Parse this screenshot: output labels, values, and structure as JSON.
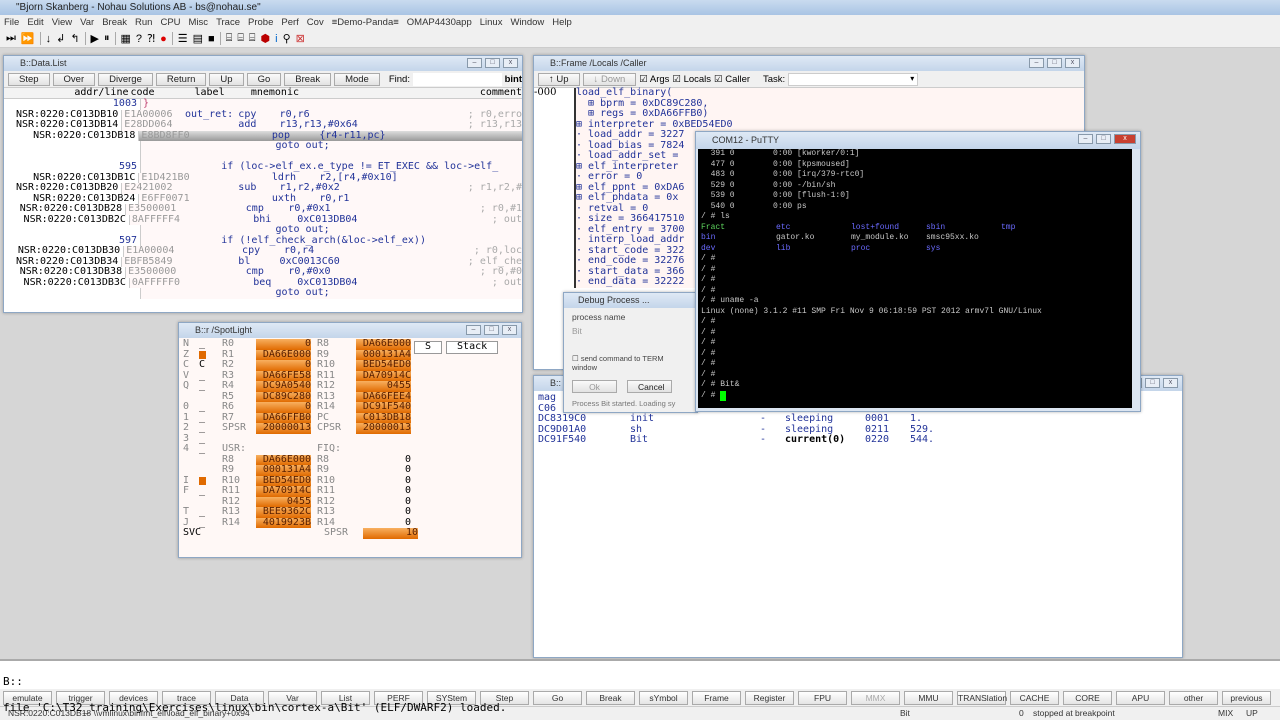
{
  "app": {
    "title": "\"Bjorn Skanberg - Nohau Solutions AB - bs@nohau.se\"",
    "menu": [
      "File",
      "Edit",
      "View",
      "Var",
      "Break",
      "Run",
      "CPU",
      "Misc",
      "Trace",
      "Probe",
      "Perf",
      "Cov",
      "≡Demo-Panda≡",
      "OMAP4430app",
      "Linux",
      "Window",
      "Help"
    ]
  },
  "datalist": {
    "title": "B::Data.List",
    "toolbar": [
      "Step",
      "Over",
      "Diverge",
      "Return",
      "Up",
      "Go",
      "Break",
      "Mode"
    ],
    "find_label": "Find:",
    "bint": "bint",
    "headers": [
      "addr/line",
      "code",
      "label",
      "mnemonic",
      "comment"
    ],
    "rows": [
      {
        "addr": "1003",
        "src": "}"
      },
      {
        "addr": "NSR:0220:C013DB10",
        "code": "E1A00006",
        "label": "out_ret:",
        "mn": "cpy",
        "ops": "r0,r6",
        "cm": "; r0,erro"
      },
      {
        "addr": "NSR:0220:C013DB14",
        "code": "E28DD064",
        "label": "",
        "mn": "add",
        "ops": "r13,r13,#0x64",
        "cm": "; r13,r13"
      },
      {
        "addr": "NSR:0220:C013DB18",
        "code": "E8BD8FF0",
        "label": "",
        "mn": "pop",
        "ops": "{r4-r11,pc}",
        "cm": "",
        "hl": true
      },
      {
        "addr": "",
        "src": "                      goto out;"
      },
      {
        "addr": "",
        "src": ""
      },
      {
        "addr": "595",
        "src": "             if (loc->elf_ex.e_type != ET_EXEC && loc->elf_"
      },
      {
        "addr": "NSR:0220:C013DB1C",
        "code": "E1D421B0",
        "label": "",
        "mn": "ldrh",
        "ops": "r2,[r4,#0x10]",
        "cm": ""
      },
      {
        "addr": "NSR:0220:C013DB20",
        "code": "E2421002",
        "label": "",
        "mn": "sub",
        "ops": "r1,r2,#0x2",
        "cm": "; r1,r2,#"
      },
      {
        "addr": "NSR:0220:C013DB24",
        "code": "E6FF0071",
        "label": "",
        "mn": "uxth",
        "ops": "r0,r1",
        "cm": ""
      },
      {
        "addr": "NSR:0220:C013DB28",
        "code": "E3500001",
        "label": "",
        "mn": "cmp",
        "ops": "r0,#0x1",
        "cm": "; r0,#1"
      },
      {
        "addr": "NSR:0220:C013DB2C",
        "code": "8AFFFFF4",
        "label": "",
        "mn": "bhi",
        "ops": "0xC013DB04",
        "cm": "; out"
      },
      {
        "addr": "",
        "src": "                      goto out;"
      },
      {
        "addr": "597",
        "src": "             if (!elf_check_arch(&loc->elf_ex))"
      },
      {
        "addr": "NSR:0220:C013DB30",
        "code": "E1A00004",
        "label": "",
        "mn": "cpy",
        "ops": "r0,r4",
        "cm": "; r0,loc"
      },
      {
        "addr": "NSR:0220:C013DB34",
        "code": "EBFB5849",
        "label": "",
        "mn": "bl",
        "ops": "0xC0013C60",
        "cm": "; elf_che"
      },
      {
        "addr": "NSR:0220:C013DB38",
        "code": "E3500000",
        "label": "",
        "mn": "cmp",
        "ops": "r0,#0x0",
        "cm": "; r0,#0"
      },
      {
        "addr": "NSR:0220:C013DB3C",
        "code": "0AFFFFF0",
        "label": "",
        "mn": "beq",
        "ops": "0xC013DB04",
        "cm": "; out"
      },
      {
        "addr": "",
        "src": "                      goto out;"
      }
    ]
  },
  "frame": {
    "title": "B::Frame /Locals /Caller",
    "up": "Up",
    "down": "Down",
    "args": "Args",
    "locals": "Locals",
    "caller": "Caller",
    "task_label": "Task:",
    "level": "-000",
    "lines": [
      "load_elf_binary(",
      "  ⊞ bprm = 0xDC89C280,",
      "  ⊞ regs = 0xDA66FFB0)",
      "⊞ interpreter = 0xBED54ED0",
      "· load_addr = 3227",
      "· load_bias = 7824",
      "· load_addr_set =",
      "⊞ elf_interpreter",
      "· error = 0",
      "⊞ elf_ppnt = 0xDA6",
      "⊞ elf_phdata = 0x",
      "· retval = 0",
      "· size = 366417510",
      "· elf_entry = 3700",
      "· interp_load_addr",
      "· start_code = 322",
      "· end_code = 32276",
      "· start_data = 366",
      "· end_data = 32222"
    ]
  },
  "spotlight": {
    "title": "B::r /SpotLight",
    "s_btn": "S",
    "stack_btn": "Stack",
    "rows": [
      [
        "N",
        "_",
        "R0",
        "0",
        "R8",
        "DA66E000"
      ],
      [
        "Z",
        "#",
        "R1",
        "DA66E000",
        "R9",
        "000131A4"
      ],
      [
        "C",
        "C",
        "R2",
        "0",
        "R10",
        "BED54ED0"
      ],
      [
        "V",
        "_",
        "R3",
        "DA66FE58",
        "R11",
        "DA70914C"
      ],
      [
        "Q",
        "_",
        "R4",
        "DC9A0540",
        "R12",
        "0455"
      ],
      [
        "",
        "",
        "R5",
        "DC89C280",
        "R13",
        "DA66FEE4"
      ],
      [
        "0",
        "_",
        "R6",
        "0",
        "R14",
        "DC91F540"
      ],
      [
        "1",
        "_",
        "R7",
        "DA66FFB0",
        "PC",
        "C013DB18"
      ],
      [
        "2",
        "_",
        "SPSR",
        "20000013",
        "CPSR",
        "20000013"
      ],
      [
        "3",
        "_",
        "",
        "",
        "",
        ""
      ],
      [
        "4",
        "_",
        "USR:",
        "",
        "FIQ:",
        ""
      ],
      [
        "",
        "",
        "R8",
        "DA66E000",
        "R8",
        "0"
      ],
      [
        "",
        "",
        "R9",
        "000131A4",
        "R9",
        "0"
      ],
      [
        "I",
        "#",
        "R10",
        "BED54ED0",
        "R10",
        "0"
      ],
      [
        "F",
        "_",
        "R11",
        "DA70914C",
        "R11",
        "0"
      ],
      [
        "",
        "",
        "R12",
        "0455",
        "R12",
        "0"
      ],
      [
        "T",
        "_",
        "R13",
        "BEE9362C",
        "R13",
        "0"
      ],
      [
        "J",
        "_",
        "R14",
        "4019923B",
        "R14",
        "0"
      ],
      [
        "SVC",
        "",
        "",
        "",
        "SPSR",
        "10"
      ]
    ]
  },
  "tasks": {
    "title": "B::",
    "rows": [
      [
        "mag",
        "",
        "",
        "",
        "",
        ""
      ],
      [
        "C06",
        "",
        "",
        "",
        "",
        ""
      ],
      [
        "DC8319C0",
        "init",
        "-",
        "sleeping",
        "0001",
        "1."
      ],
      [
        "DC9D01A0",
        "sh",
        "-",
        "sleeping",
        "0211",
        "529."
      ],
      [
        "DC91F540",
        "Bit",
        "-",
        "current(0)",
        "0220",
        "544."
      ]
    ],
    "scroll_num": "5"
  },
  "debugdlg": {
    "title": "Debug Process ...",
    "group": "process name",
    "value": "Bit",
    "checkbox": "send command to TERM window",
    "ok": "Ok",
    "cancel": "Cancel",
    "status": "Process Bit started. Loading sy"
  },
  "putty": {
    "title": "COM12 - PuTTY",
    "lines": [
      "  391 0        0:00 [kworker/0:1]",
      "  477 0        0:00 [kpsmoused]",
      "  483 0        0:00 [irq/379-rtc0]",
      "  529 0        0:00 -/bin/sh",
      "  539 0        0:00 [flush-1:0]",
      "  540 0        0:00 ps",
      "/ # ls"
    ],
    "ls": [
      [
        [
          "Fract",
          "#5fd75f"
        ],
        [
          "etc",
          "#6b6bff"
        ],
        [
          "lost+found",
          "#6b6bff"
        ],
        [
          "sbin",
          "#6b6bff"
        ],
        [
          "tmp",
          "#6b6bff"
        ]
      ],
      [
        [
          "bin",
          "#6b6bff"
        ],
        [
          "gator.ko",
          ""
        ],
        [
          "my_module.ko",
          ""
        ],
        [
          "smsc95xx.ko",
          ""
        ]
      ],
      [
        [
          "dev",
          "#6b6bff"
        ],
        [
          "lib",
          "#6b6bff"
        ],
        [
          "proc",
          "#6b6bff"
        ],
        [
          "sys",
          "#6b6bff"
        ]
      ]
    ],
    "after": [
      "/ #",
      "/ #",
      "/ #",
      "/ #",
      "/ # uname -a",
      "Linux (none) 3.1.2 #11 SMP Fri Nov 9 06:18:59 PST 2012 armv7l GNU/Linux",
      "/ #",
      "/ #",
      "/ #",
      "/ #",
      "/ #",
      "/ #",
      "/ # Bit&"
    ],
    "prompt": "/ # "
  },
  "command": {
    "prompt": "B::",
    "message": "file 'C:\\T32_training\\Exercises\\linux\\bin\\cortex-a\\Bit' (ELF/DWARF2) loaded."
  },
  "buttons": [
    "emulate",
    "trigger",
    "devices",
    "trace",
    "Data",
    "Var",
    "List",
    "PERF",
    "SYStem",
    "Step",
    "Go",
    "Break",
    "sYmbol",
    "Frame",
    "Register",
    "FPU",
    "MMX",
    "MMU",
    "TRANSlation",
    "CACHE",
    "CORE",
    "APU",
    "other",
    "previous"
  ],
  "status": {
    "location": "NSR:0220:C013DB18  \\\\vmlinux\\binfmt_elf\\load_elf_binary+0x94",
    "task": "Bit",
    "core": "0",
    "state": "stopped at breakpoint",
    "mode": "MIX",
    "updown": "UP"
  },
  "colors": {
    "register_fill": "#e06a00",
    "terminal_bg": "#000000",
    "cursor": "#00ff00"
  }
}
